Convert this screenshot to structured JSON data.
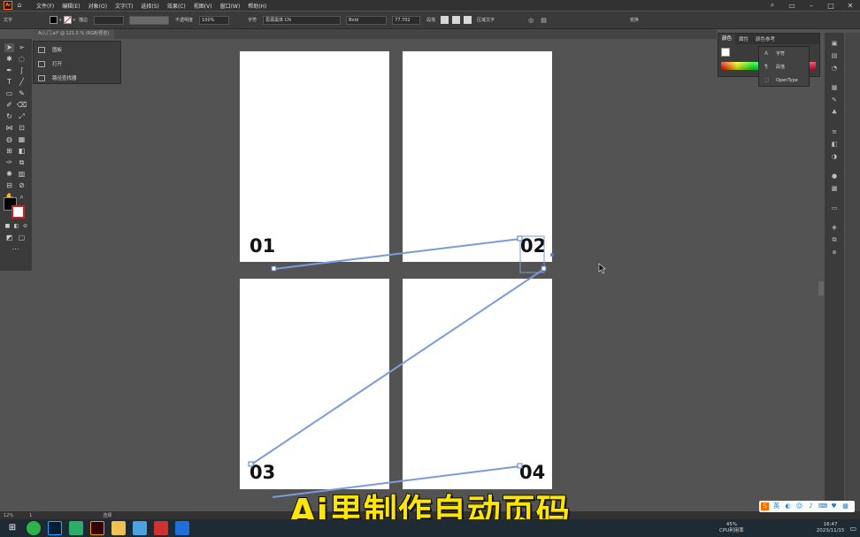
{
  "menubar": {
    "logo": "Ai",
    "items": [
      "文件(F)",
      "编辑(E)",
      "对象(O)",
      "文字(T)",
      "选择(S)",
      "效果(C)",
      "视图(V)",
      "窗口(W)",
      "帮助(H)"
    ]
  },
  "control": {
    "mode_label": "文字",
    "stroke_label": "描边",
    "opacity_label": "不透明度",
    "opacity_value": "100%",
    "char_label": "字符",
    "font_name": "思源黑体 CN",
    "font_style": "Bold",
    "font_size": "77.702",
    "para_label": "段落",
    "area_text_label": "区域文字",
    "transform_label": "变换"
  },
  "document": {
    "tab_title": "Ai入门.ai* @ 121.5 % (RGB/预览)"
  },
  "flyout": {
    "items": [
      "图板",
      "打开",
      "路径查找器"
    ]
  },
  "artboards": [
    {
      "page": "01"
    },
    {
      "page": "02"
    },
    {
      "page": "03"
    },
    {
      "page": "04"
    }
  ],
  "right_panel": {
    "tabs": [
      "颜色",
      "属性",
      "颜色参考"
    ],
    "menu_items": [
      "字符",
      "段落",
      "OpenType"
    ]
  },
  "statusbar": {
    "zoom": "12%",
    "page": "1",
    "status": "选择"
  },
  "caption": "Ai里制作自动页码",
  "taskbar": {
    "cpu_percent": "45%",
    "cpu_label": "CPU利用率",
    "time": "16:47",
    "date": "2023/11/15"
  },
  "colors": {
    "link_line": "#7a9cd8",
    "caption_text": "#ffe600",
    "canvas": "#535353"
  }
}
